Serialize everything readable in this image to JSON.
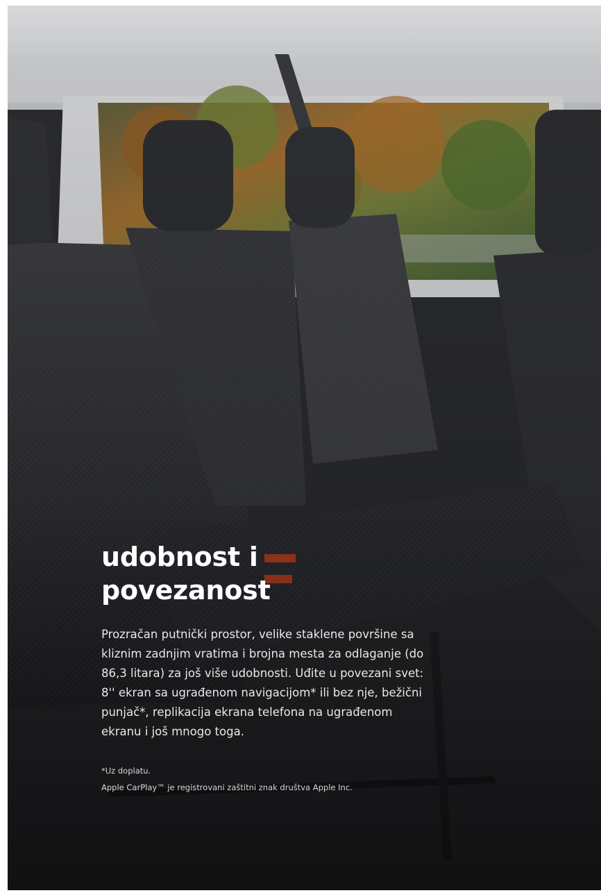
{
  "hero": {
    "image_alt": "Van passenger interior with dark fabric bench seats"
  },
  "heading": {
    "line1": "udobnost i",
    "line2": "povezanost"
  },
  "body": {
    "paragraph": "Prozračan putnički prostor, velike staklene površine sa kliznim zadnjim vratima i brojna mesta za odlaganje (do 86,3 litara) za još više udobnosti. Uđite u povezani svet: 8'' ekran sa ugrađenom navigacijom* ili bez nje, bežični punjač*, replikacija ekrana telefona na ugrađenom ekranu i još mnogo toga."
  },
  "footnotes": {
    "note1": "*Uz doplatu.",
    "note2": "Apple CarPlay™ je registrovani zaštitni znak društva Apple Inc."
  },
  "colors": {
    "text_primary": "#ffffff",
    "text_secondary": "#e9e9ea",
    "seat_fabric": "#2c2d31",
    "foliage": "#7a6a2c"
  }
}
